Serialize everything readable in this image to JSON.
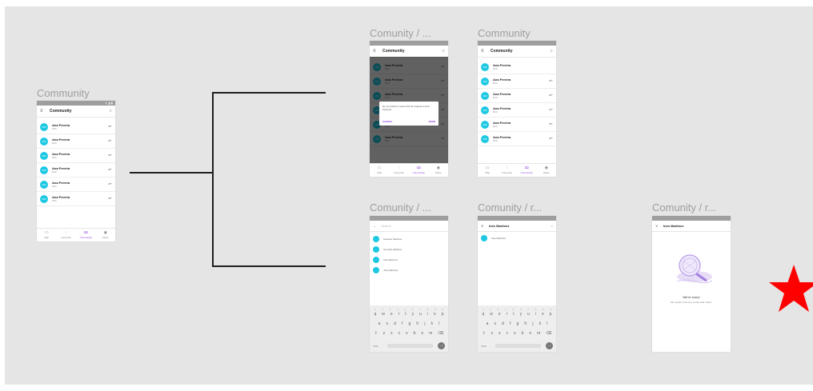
{
  "canvas": {
    "background": "#e5e5e5"
  },
  "accent": {
    "avatar": "#1ec8e3",
    "primary": "#8b3fe8",
    "star": "#ff0000"
  },
  "frames": [
    {
      "title": "Community",
      "statusbar": "▾ ◢ ▮",
      "appbar": {
        "menu_icon": "≡",
        "title": "Community",
        "search_icon": "⌕"
      },
      "items": [
        {
          "avatar": "NW",
          "name": "Ana Pereira",
          "sub": "Birth"
        },
        {
          "avatar": "NW",
          "name": "Ana Pereira",
          "sub": "Birth"
        },
        {
          "avatar": "NW",
          "name": "Ana Pereira",
          "sub": "Birth"
        },
        {
          "avatar": "NW",
          "name": "Ana Pereira",
          "sub": "Birth"
        },
        {
          "avatar": "NW",
          "name": "Ana Pereira",
          "sub": "Birth"
        },
        {
          "avatar": "NW",
          "name": "Ana Pereira",
          "sub": "Birth"
        }
      ],
      "nav": [
        {
          "icon": "▭",
          "label": "Map"
        },
        {
          "icon": "◌",
          "label": "Favourite"
        },
        {
          "icon": "ꝏ",
          "label": "Community"
        },
        {
          "icon": "◉",
          "label": "Share"
        }
      ]
    },
    {
      "title": "Comunity / ...",
      "appbar": {
        "menu_icon": "≡",
        "title": "Community",
        "search_icon": "⌕"
      },
      "items": [
        {
          "avatar": "NW",
          "name": "Ana Pereira",
          "sub": "Birth"
        },
        {
          "avatar": "NW",
          "name": "Ana Pereira",
          "sub": "Birth"
        },
        {
          "avatar": "NW",
          "name": "Ana Pereira",
          "sub": "Birth"
        },
        {
          "avatar": "NW",
          "name": "Ana Pereira",
          "sub": "Birth"
        },
        {
          "avatar": "NW",
          "name": "Ana Pereira",
          "sub": "Birth"
        },
        {
          "avatar": "NW",
          "name": "Ana Pereira",
          "sub": "Birth"
        }
      ],
      "dialog": {
        "message": "Do you want to send a friend request to Ana Pereira?",
        "cancel": "CANCEL",
        "send": "SEND"
      },
      "nav": [
        {
          "icon": "▭",
          "label": "Map"
        },
        {
          "icon": "◌",
          "label": "Favourite"
        },
        {
          "icon": "ꝏ",
          "label": "Community"
        },
        {
          "icon": "◉",
          "label": "Share"
        }
      ]
    },
    {
      "title": "Community",
      "appbar": {
        "menu_icon": "≡",
        "title": "Community",
        "search_icon": "⌕"
      },
      "items": [
        {
          "avatar": "NW",
          "name": "Ana Pereira",
          "sub": "Birth"
        },
        {
          "avatar": "NW",
          "name": "Ana Pereira",
          "sub": "Birth"
        },
        {
          "avatar": "NW",
          "name": "Ana Pereira",
          "sub": "Birth"
        },
        {
          "avatar": "NW",
          "name": "Ana Pereira",
          "sub": "Birth"
        },
        {
          "avatar": "NW",
          "name": "Ana Pereira",
          "sub": "Birth"
        },
        {
          "avatar": "NW",
          "name": "Ana Pereira",
          "sub": "Birth"
        }
      ],
      "nav": [
        {
          "icon": "▭",
          "label": "Map"
        },
        {
          "icon": "◌",
          "label": "Favourite"
        },
        {
          "icon": "ꝏ",
          "label": "Community"
        },
        {
          "icon": "◉",
          "label": "Share"
        }
      ]
    },
    {
      "title": "Comunity / ...",
      "search": {
        "back_icon": "←",
        "placeholder": "Search"
      },
      "results": [
        "Gustavo Martinez",
        "Gonzalo Martinez",
        "Inés Martinez",
        "José Martinez"
      ],
      "keyboard": {
        "numbers": [
          "1",
          "2",
          "3",
          "4",
          "5",
          "6",
          "7",
          "8",
          "9",
          "0"
        ],
        "row1": [
          "q",
          "w",
          "e",
          "r",
          "t",
          "y",
          "u",
          "i",
          "o",
          "p"
        ],
        "row2": [
          "a",
          "s",
          "d",
          "f",
          "g",
          "h",
          "j",
          "k",
          "l"
        ],
        "row3": [
          "⇧",
          "z",
          "x",
          "c",
          "v",
          "b",
          "n",
          "m",
          "⌫"
        ],
        "left": "?123",
        "comma": ",",
        "enter": "→"
      }
    },
    {
      "title": "Comunity / r...",
      "search": {
        "close_icon": "✕",
        "query": "Inés Martinez",
        "search_icon": "⌕"
      },
      "results": [
        "Inés Martinez"
      ],
      "keyboard": {
        "numbers": [
          "1",
          "2",
          "3",
          "4",
          "5",
          "6",
          "7",
          "8",
          "9",
          "0"
        ],
        "row1": [
          "q",
          "w",
          "e",
          "r",
          "t",
          "y",
          "u",
          "i",
          "o",
          "p"
        ],
        "row2": [
          "a",
          "s",
          "d",
          "f",
          "g",
          "h",
          "j",
          "k",
          "l"
        ],
        "row3": [
          "⇧",
          "z",
          "x",
          "c",
          "v",
          "b",
          "n",
          "m",
          "⌫"
        ],
        "left": "?123",
        "comma": ",",
        "enter": "→"
      }
    },
    {
      "title": "Comunity / r...",
      "search": {
        "close_icon": "✕",
        "query": "Inés Martinez"
      },
      "empty": {
        "title": "We're sorry!",
        "message": "We couldn't find any results that match."
      }
    }
  ],
  "star_icon": "star-icon"
}
